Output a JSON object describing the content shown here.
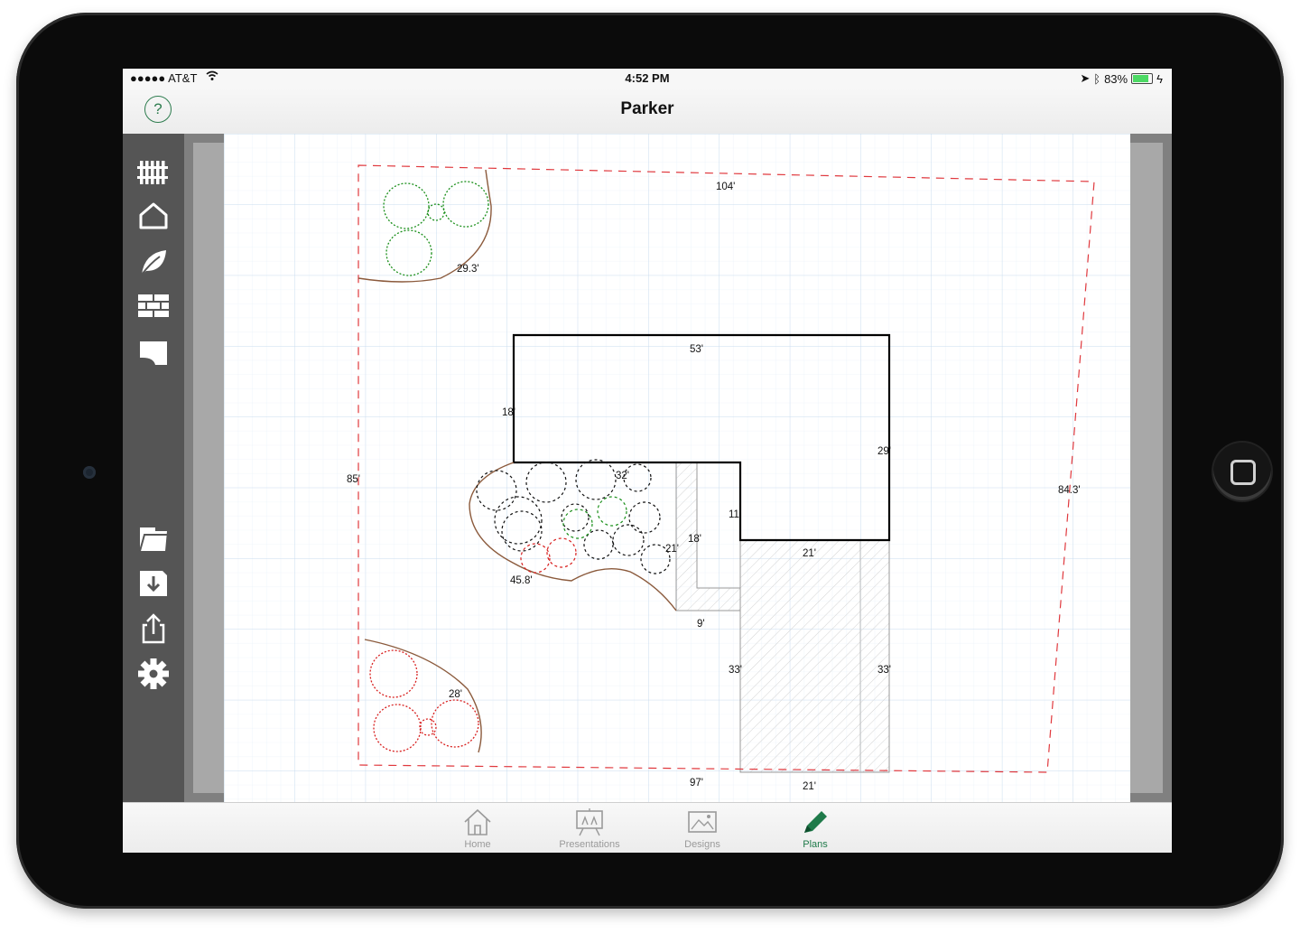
{
  "status_bar": {
    "carrier": "●●●●● AT&T",
    "time": "4:52 PM",
    "battery_percent": "83%",
    "battery_level": 0.83
  },
  "nav": {
    "title": "Parker",
    "help_label": "?"
  },
  "sidebar_tools": [
    {
      "icon": "fence-icon"
    },
    {
      "icon": "house-outline-icon"
    },
    {
      "icon": "leaf-icon"
    },
    {
      "icon": "brick-wall-icon"
    },
    {
      "icon": "paver-icon"
    },
    {
      "icon": "open-folder-icon"
    },
    {
      "icon": "import-icon"
    },
    {
      "icon": "share-icon"
    },
    {
      "icon": "gear-icon"
    }
  ],
  "plan": {
    "dimensions": {
      "top_property": "104'",
      "left_property": "85'",
      "right_property": "84.3'",
      "bottom_property": "97'",
      "green_bed": "29.3'",
      "red_bed": "28'",
      "house_top": "53'",
      "house_left": "18'",
      "house_right": "29'",
      "house_notch_vertical": "11'",
      "house_bottom": "21'",
      "front_bed": "45.8'",
      "front_bed_right": "32'",
      "walk_vertical": "18'",
      "walk_horizontal": "21'",
      "walk_bottom": "9'",
      "driveway_left": "33'",
      "driveway_right": "33'",
      "driveway_bottom": "21'"
    },
    "colors": {
      "property_line": "#e0393e",
      "house": "#000000",
      "bed_outline": "#8b5a3c",
      "green_plant": "#1a8f1a",
      "red_plant": "#d8201f",
      "grid_line": "#c9dcef"
    }
  },
  "tabs": [
    {
      "label": "Home",
      "icon": "home-icon",
      "active": false
    },
    {
      "label": "Presentations",
      "icon": "presentation-icon",
      "active": false
    },
    {
      "label": "Designs",
      "icon": "image-icon",
      "active": false
    },
    {
      "label": "Plans",
      "icon": "pencil-icon",
      "active": true
    }
  ]
}
